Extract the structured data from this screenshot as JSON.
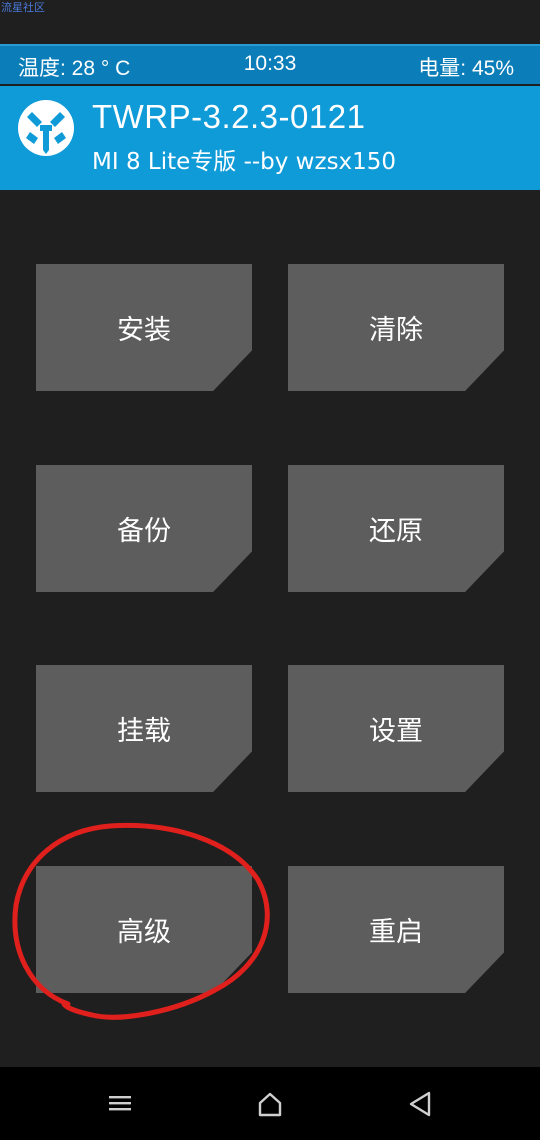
{
  "watermark": "流星社区",
  "status": {
    "temperature": "温度: 28 ° C",
    "time": "10:33",
    "battery": "电量: 45%"
  },
  "header": {
    "title": "TWRP-3.2.3-0121",
    "subtitle": "MI 8 Lite专版 --by wzsx150"
  },
  "menu": [
    {
      "label": "安装"
    },
    {
      "label": "清除"
    },
    {
      "label": "备份"
    },
    {
      "label": "还原"
    },
    {
      "label": "挂载"
    },
    {
      "label": "设置"
    },
    {
      "label": "高级"
    },
    {
      "label": "重启"
    }
  ],
  "nav": {
    "icons": [
      "menu-icon",
      "home-icon",
      "back-icon"
    ]
  },
  "colors": {
    "status_bar": "#0b7db8",
    "header": "#0f9ad8",
    "tile": "#5d5d5d",
    "annotation": "#e0201c"
  }
}
